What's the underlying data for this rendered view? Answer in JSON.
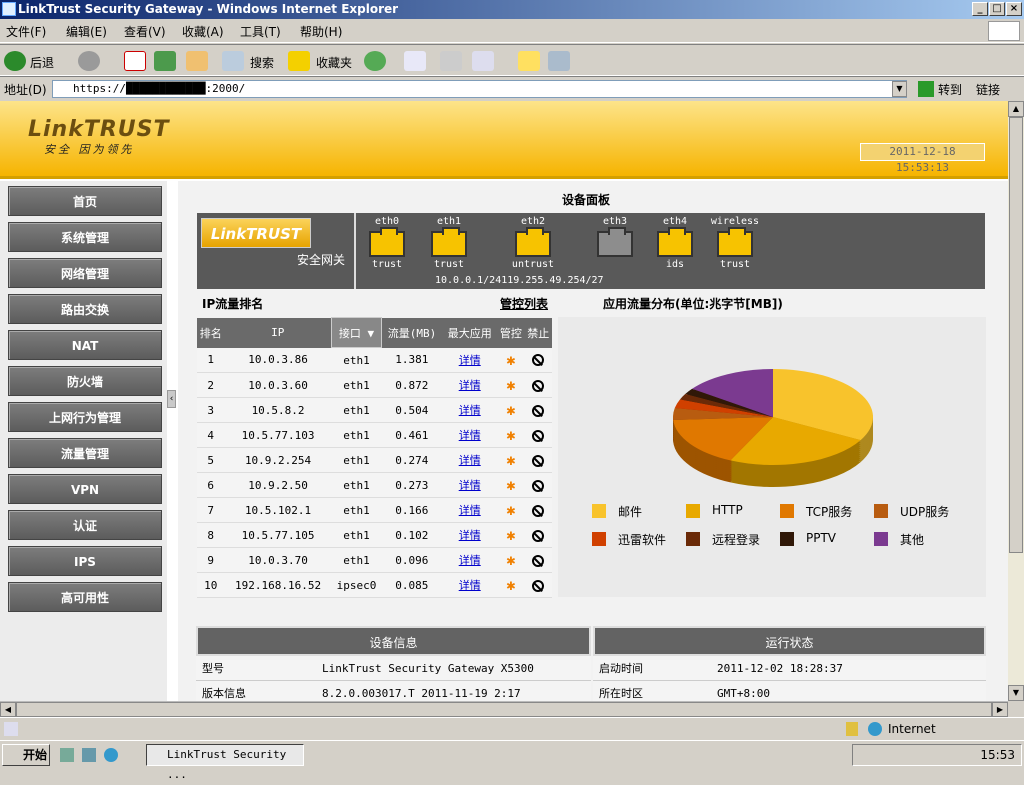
{
  "window": {
    "title": "LinkTrust Security Gateway - Windows Internet Explorer"
  },
  "menu": [
    "文件(F)",
    "编辑(E)",
    "查看(V)",
    "收藏(A)",
    "工具(T)",
    "帮助(H)"
  ],
  "toolbar": {
    "back": "后退",
    "search": "搜索",
    "favorites": "收藏夹"
  },
  "address": {
    "label": "地址(D)",
    "url": "https://████████████:2000/",
    "go": "转到",
    "links": "链接"
  },
  "banner": {
    "logo": "LinkTRUST",
    "slogan": "安全 因为领先",
    "datetime": "2011-12-18 15:53:13"
  },
  "sidebar": [
    "首页",
    "系统管理",
    "网络管理",
    "路由交换",
    "NAT",
    "防火墙",
    "上网行为管理",
    "流量管理",
    "VPN",
    "认证",
    "IPS",
    "高可用性"
  ],
  "panel": {
    "title": "设备面板",
    "device_logo": "LinkTRUST",
    "device_name": "安全网关",
    "ports": [
      {
        "name": "eth0",
        "zone": "trust",
        "up": true
      },
      {
        "name": "eth1",
        "zone": "trust",
        "up": true
      },
      {
        "name": "eth2",
        "zone": "untrust",
        "up": true
      },
      {
        "name": "eth3",
        "zone": "",
        "up": false
      },
      {
        "name": "eth4",
        "zone": "ids",
        "up": true
      },
      {
        "name": "wireless",
        "zone": "trust",
        "up": true
      }
    ],
    "ip_line": "10.0.0.1/24119.255.49.254/27"
  },
  "ip_rank": {
    "title": "IP流量排名",
    "control_list": "管控列表",
    "headers": [
      "排名",
      "IP",
      "接口",
      "流量(MB)",
      "最大应用",
      "管控",
      "禁止"
    ],
    "detail_label": "详情",
    "rows": [
      [
        "1",
        "10.0.3.86",
        "eth1",
        "1.381"
      ],
      [
        "2",
        "10.0.3.60",
        "eth1",
        "0.872"
      ],
      [
        "3",
        "10.5.8.2",
        "eth1",
        "0.504"
      ],
      [
        "4",
        "10.5.77.103",
        "eth1",
        "0.461"
      ],
      [
        "5",
        "10.9.2.254",
        "eth1",
        "0.274"
      ],
      [
        "6",
        "10.9.2.50",
        "eth1",
        "0.273"
      ],
      [
        "7",
        "10.5.102.1",
        "eth1",
        "0.166"
      ],
      [
        "8",
        "10.5.77.105",
        "eth1",
        "0.102"
      ],
      [
        "9",
        "10.0.3.70",
        "eth1",
        "0.096"
      ],
      [
        "10",
        "192.168.16.52",
        "ipsec0",
        "0.085"
      ]
    ]
  },
  "chart_data": {
    "type": "pie",
    "title": "应用流量分布(单位:兆字节[MB])",
    "slices": [
      {
        "label": "邮件",
        "value": 33,
        "color": "#f8c32c"
      },
      {
        "label": "HTTP",
        "value": 24,
        "color": "#e8a900"
      },
      {
        "label": "TCP服务",
        "value": 17,
        "color": "#e07800"
      },
      {
        "label": "UDP服务",
        "value": 4,
        "color": "#b85c10"
      },
      {
        "label": "迅雷软件",
        "value": 3,
        "color": "#d04000"
      },
      {
        "label": "远程登录",
        "value": 2,
        "color": "#6a2a08"
      },
      {
        "label": "PPTV",
        "value": 2,
        "color": "#301808"
      },
      {
        "label": "其他",
        "value": 15,
        "color": "#7b3a90"
      }
    ],
    "legend": "bottom"
  },
  "info": {
    "device_header": "设备信息",
    "status_header": "运行状态",
    "model_label": "型号",
    "model_value": "LinkTrust Security Gateway X5300",
    "version_label": "版本信息",
    "version_value": "8.2.0.003017.T 2011-11-19 2:17",
    "boot_label": "启动时间",
    "boot_value": "2011-12-02 18:28:37",
    "tz_label": "所在时区",
    "tz_value": "GMT+8:00"
  },
  "status": {
    "zone": "Internet"
  },
  "taskbar": {
    "start": "开始",
    "task": "LinkTrust Security ...",
    "clock": "15:53"
  }
}
